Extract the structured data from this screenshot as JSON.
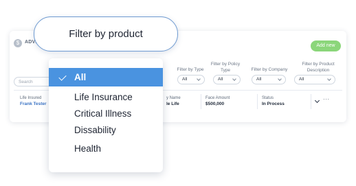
{
  "header": {
    "logo_glyph": "$",
    "title": "ADVI",
    "add_button": "Add new"
  },
  "search": {
    "placeholder": "Search"
  },
  "filters": [
    {
      "label": "Filter by Type",
      "value": "All"
    },
    {
      "label": "Filter by Policy Type",
      "value": "All"
    },
    {
      "label": "Filter by Company",
      "value": "All"
    },
    {
      "label": "Filter by Product Description",
      "value": "All"
    }
  ],
  "row": {
    "insured_label": "Life Insured",
    "insured_name": "Frank Tester",
    "policy_label": "y Name",
    "policy_value": "le Life",
    "face_label": "Face Amount",
    "face_value": "$500,000",
    "status_label": "Status",
    "status_value": "In Process",
    "more": "···"
  },
  "callout": {
    "text": "Filter by product"
  },
  "dropdown": {
    "options": [
      "All",
      "Life Insurance",
      "Critical Illness",
      "Dissability",
      "Health"
    ],
    "selected": "All"
  },
  "colors": {
    "accent": "#4a93e0",
    "add_button": "#8bd67a",
    "link": "#3b73c4"
  },
  "icons": {
    "selected_check": "check-icon",
    "row_expand": "chevron-down-icon",
    "row_menu": "more-icon"
  }
}
